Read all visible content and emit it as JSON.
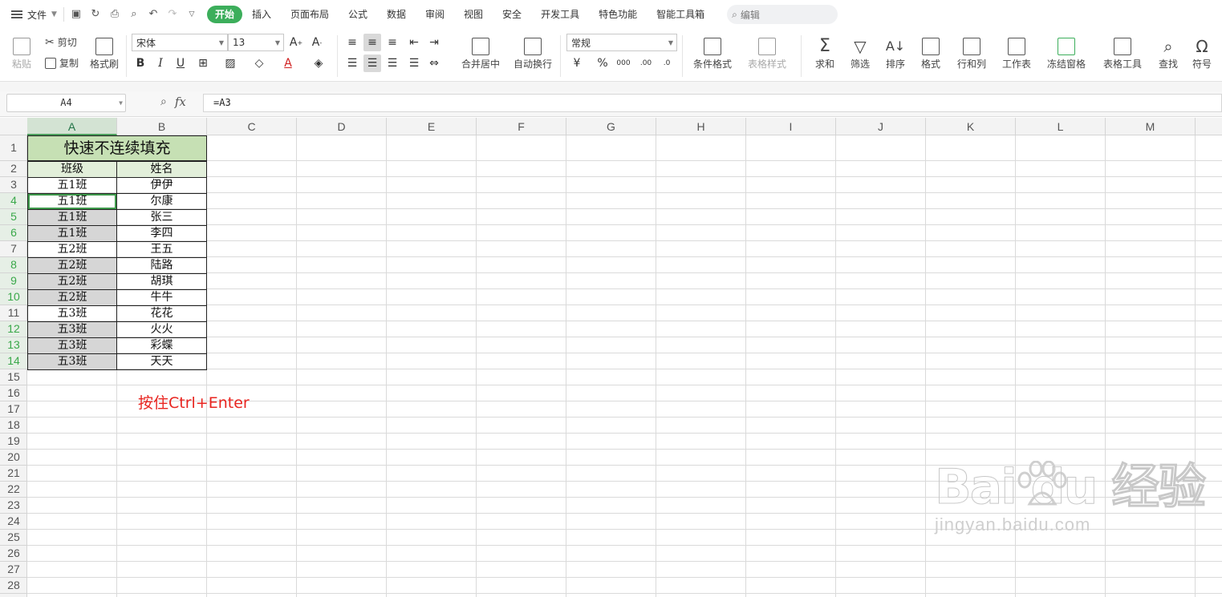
{
  "menubar": {
    "file_label": "文件",
    "tabs": [
      {
        "label": "开始",
        "active": true
      },
      {
        "label": "插入"
      },
      {
        "label": "页面布局"
      },
      {
        "label": "公式"
      },
      {
        "label": "数据"
      },
      {
        "label": "审阅"
      },
      {
        "label": "视图"
      },
      {
        "label": "安全"
      },
      {
        "label": "开发工具"
      },
      {
        "label": "特色功能"
      },
      {
        "label": "智能工具箱"
      }
    ],
    "search_placeholder": "编辑"
  },
  "ribbon": {
    "paste": "粘贴",
    "cut": "剪切",
    "copy": "复制",
    "format_painter": "格式刷",
    "font_name": "宋体",
    "font_size": "13",
    "merge_center": "合并居中",
    "wrap_text": "自动换行",
    "number_format": "常规",
    "conditional_format": "条件格式",
    "table_style": "表格样式",
    "sum": "求和",
    "filter": "筛选",
    "sort": "排序",
    "format": "格式",
    "rows_cols": "行和列",
    "worksheet": "工作表",
    "freeze": "冻结窗格",
    "table_tools": "表格工具",
    "find": "查找",
    "symbol": "符号",
    "bold": "B",
    "italic": "I",
    "underline": "U",
    "percent": "%"
  },
  "formula_bar": {
    "name_box": "A4",
    "fx": "fx",
    "formula": "=A3"
  },
  "columns": [
    "A",
    "B",
    "C",
    "D",
    "E",
    "F",
    "G",
    "H",
    "I",
    "J",
    "K",
    "L",
    "M"
  ],
  "rows": [
    "1",
    "2",
    "3",
    "4",
    "5",
    "6",
    "7",
    "8",
    "9",
    "10",
    "11",
    "12",
    "13",
    "14",
    "15",
    "16",
    "17",
    "18",
    "19",
    "20",
    "21",
    "22",
    "23",
    "24",
    "25",
    "26",
    "27",
    "28"
  ],
  "sheet": {
    "title": "快速不连续填充",
    "header_a": "班级",
    "header_b": "姓名",
    "data": [
      {
        "a": "五1班",
        "b": "伊伊"
      },
      {
        "a": "五1班",
        "b": "尔康"
      },
      {
        "a": "五1班",
        "b": "张三"
      },
      {
        "a": "五1班",
        "b": "李四"
      },
      {
        "a": "五2班",
        "b": "王五"
      },
      {
        "a": "五2班",
        "b": "陆路"
      },
      {
        "a": "五2班",
        "b": "胡琪"
      },
      {
        "a": "五2班",
        "b": "牛牛"
      },
      {
        "a": "五3班",
        "b": "花花"
      },
      {
        "a": "五3班",
        "b": "火火"
      },
      {
        "a": "五3班",
        "b": "彩蝶"
      },
      {
        "a": "五3班",
        "b": "天天"
      }
    ],
    "hint": "按住Ctrl+Enter"
  },
  "watermark": {
    "brand": "Bai du 经验",
    "url": "jingyan.baidu.com"
  },
  "colors": {
    "accent": "#3cae5b",
    "title_fill": "#c6e0b4",
    "header_fill": "#e2efda",
    "selected_fill": "#d6d6d6",
    "hint": "#e8241f"
  }
}
